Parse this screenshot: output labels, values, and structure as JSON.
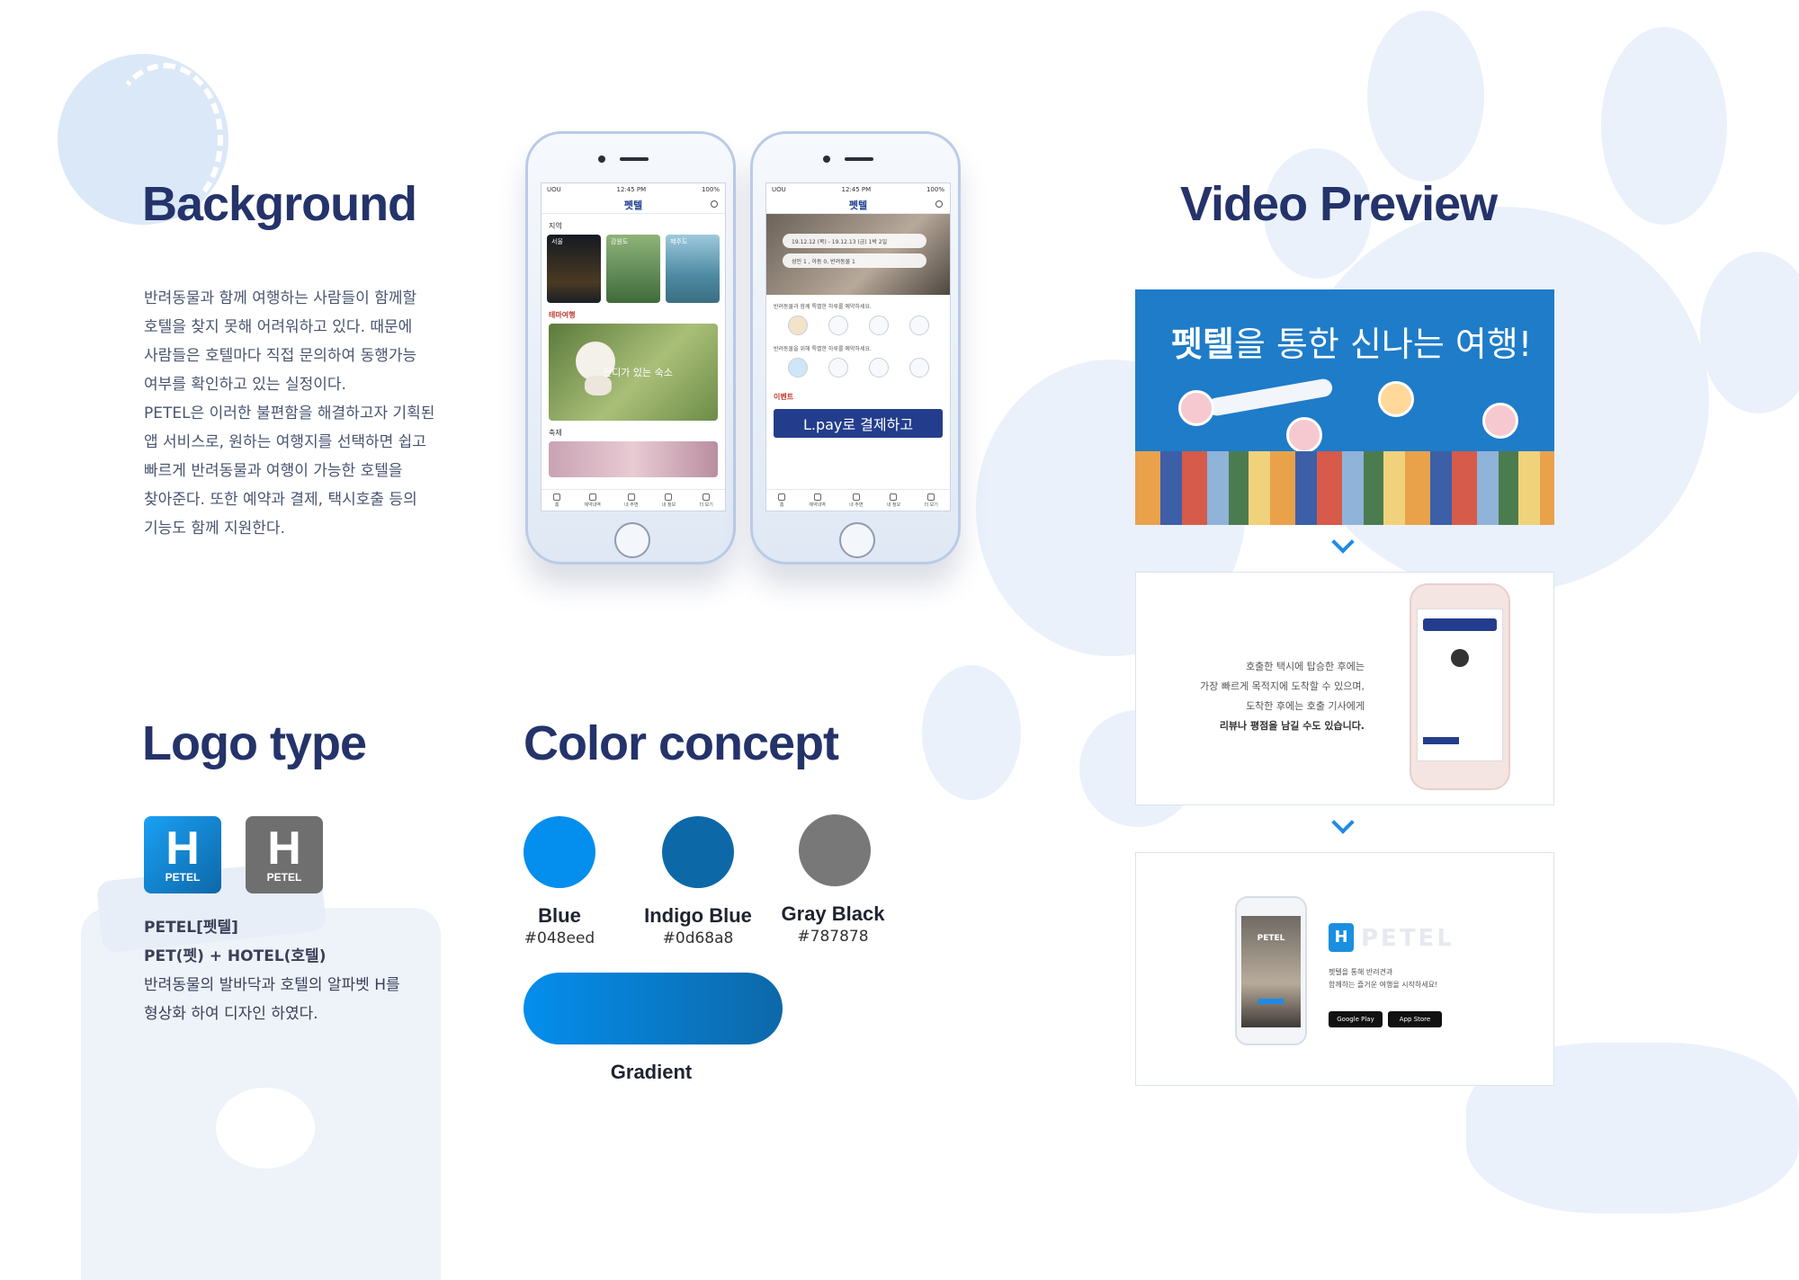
{
  "background": {
    "title": "Background",
    "lines": [
      "반려동물과 함께 여행하는 사람들이 함께할",
      "호텔을 찾지 못해 어려워하고 있다. 때문에",
      "사람들은 호텔마다 직접 문의하여 동행가능",
      "여부를 확인하고 있는 실정이다.",
      "PETEL은 이러한 불편함을 해결하고자 기획된",
      "앱 서비스로, 원하는 여행지를 선택하면 쉽고",
      "빠르게 반려동물과 여행이 가능한 호텔을",
      "찾아준다. 또한 예약과 결제, 택시호출 등의",
      "기능도 함께 지원한다."
    ]
  },
  "phones": {
    "status_carrier": "UOU",
    "status_time": "12:45 PM",
    "status_battery": "100%",
    "app_title": "펫텔",
    "phone1": {
      "section_region": "지역",
      "regions": [
        "서울",
        "강원도",
        "제주도"
      ],
      "section_theme": "테마여행",
      "theme_caption": "잔디가 있는 숙소",
      "section_festival": "축제"
    },
    "phone2": {
      "date_pill": "19.12.12 (목) - 19.12.13 (금)   1박 2일",
      "guest_pill": "성인 1 , 아동 0, 반려동물 1",
      "line1": "반려동물과 함께 특별한 하루를 예약하세요.",
      "line2": "반려동물을 위해 특별한 하루를 예약하세요.",
      "event_label": "이벤트",
      "event_banner": "L.pay로 결제하고"
    },
    "tabs": [
      "홈",
      "예약내역",
      "내 주변",
      "내 정보",
      "더 보기"
    ]
  },
  "logo": {
    "title": "Logo type",
    "tile_letter": "H",
    "tile_label": "PETEL",
    "lines": [
      "PETEL[펫텔]",
      "PET(펫) + HOTEL(호텔)",
      "반려동물의 발바닥과 호텔의 알파벳 H를",
      "형상화 하여 디자인 하였다."
    ]
  },
  "colors": {
    "title": "Color concept",
    "swatches": [
      {
        "name": "Blue",
        "hex": "#048eed"
      },
      {
        "name": "Indigo Blue",
        "hex": "#0d68a8"
      },
      {
        "name": "Gray Black",
        "hex": "#787878"
      }
    ],
    "gradient_label": "Gradient"
  },
  "video": {
    "title": "Video Preview",
    "banner_bold": "펫텔",
    "banner_rest": "을 통한 신나는 여행!",
    "frame2_lines": [
      "호출한 택시에 탑승한 후에는",
      "가장 빠르게 목적지에 도착할 수 있으며,",
      "도착한 후에는 호출 기사에게",
      "리뷰나 평점을 남길 수도 있습니다."
    ],
    "frame3_phone_label": "PETEL",
    "frame3_brand": "PETEL",
    "frame3_lines": [
      "펫텔을 통해 반려견과",
      "함께하는 즐거운 여행을 시작하세요!"
    ],
    "store1": "Google Play",
    "store2": "App Store"
  }
}
